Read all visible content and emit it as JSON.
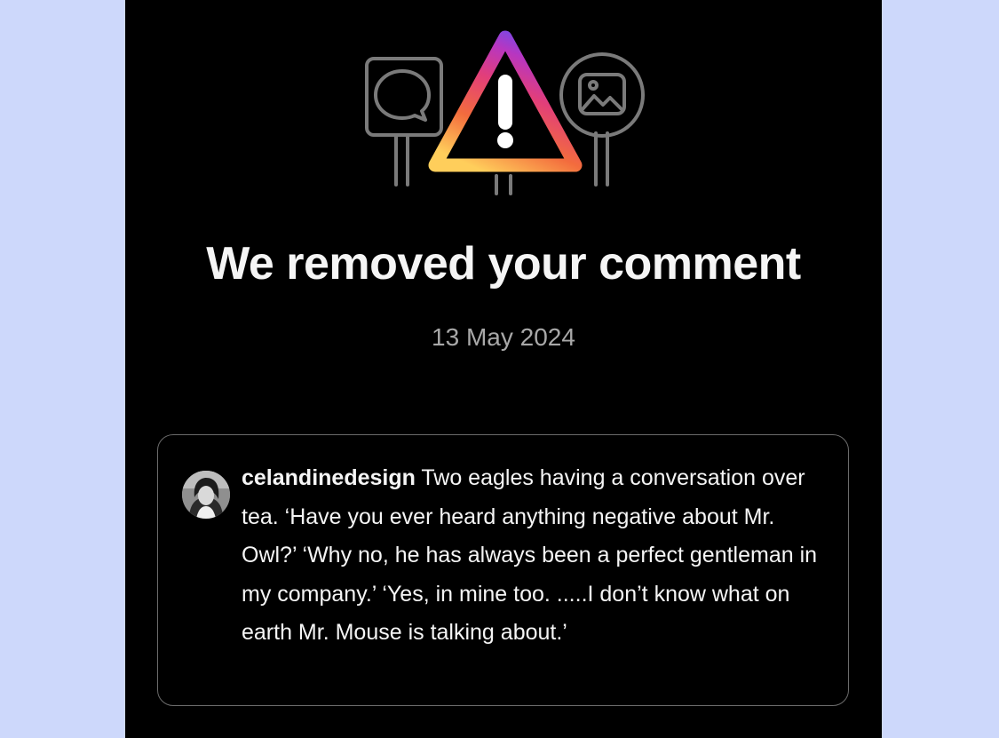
{
  "notice": {
    "title": "We removed your comment",
    "date": "13 May 2024"
  },
  "comment": {
    "username": "celandinedesign",
    "text": "Two eagles having a conversation over tea. ‘Have you ever heard anything negative about Mr. Owl?’ ‘Why no, he has always been a perfect gentleman in my company.’ ‘Yes, in mine too. .....I don’t know what on earth Mr. Mouse is talking about.’"
  },
  "icons": {
    "warning": "warning-triangle-icon",
    "comment_sign": "comment-bubble-icon",
    "image_sign": "image-icon",
    "avatar": "avatar"
  },
  "colors": {
    "background": "#000000",
    "page_outside": "#cdd8fb",
    "title": "#f5f5f5",
    "date": "#a8a8a8",
    "card_border": "#6b6b6b",
    "warning_gradient": [
      "#ffce5b",
      "#f36c3d",
      "#e23e7a",
      "#b836c0",
      "#6a4df0"
    ]
  }
}
